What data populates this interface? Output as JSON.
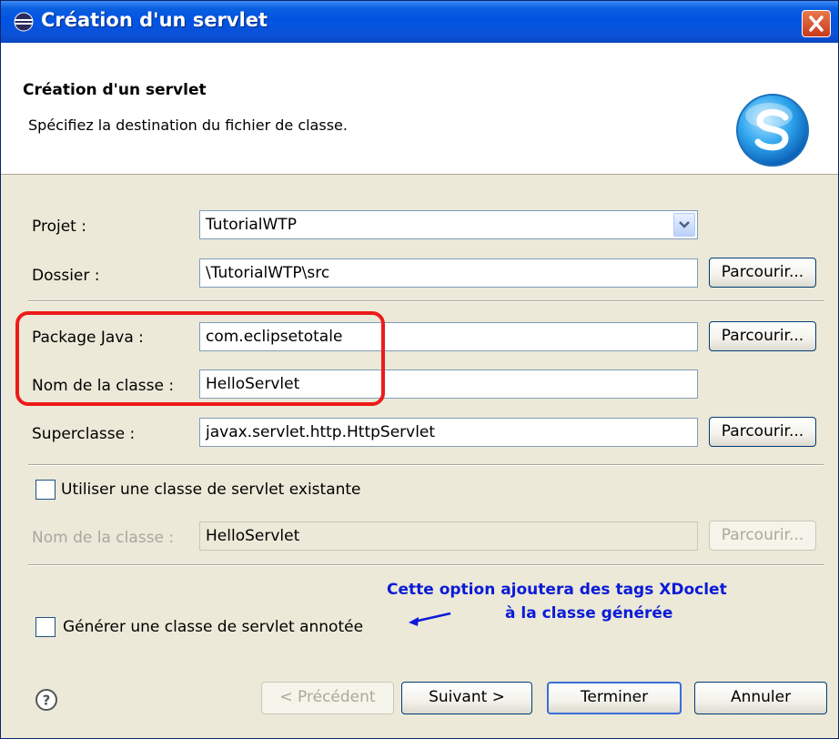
{
  "window": {
    "title": "Création d'un servlet"
  },
  "header": {
    "title": "Création d'un servlet",
    "description": "Spécifiez la destination du fichier de classe."
  },
  "form": {
    "project_label": "Projet :",
    "project_value": "TutorialWTP",
    "folder_label": "Dossier :",
    "folder_value": "\\TutorialWTP\\src",
    "package_label": "Package Java :",
    "package_value": "com.eclipsetotale",
    "class_label": "Nom de la classe :",
    "class_value": "HelloServlet",
    "superclass_label": "Superclasse :",
    "superclass_value": "javax.servlet.http.HttpServlet",
    "browse_label": "Parcourir...",
    "use_existing_label": "Utiliser une classe de servlet existante",
    "use_existing_checked": false,
    "existing_class_label": "Nom de la classe :",
    "existing_class_value": "HelloServlet",
    "annotated_label": "Générer une classe de servlet annotée",
    "annotated_checked": false
  },
  "annotation": {
    "line1": "Cette option ajoutera des tags XDoclet",
    "line2": "à la classe générée",
    "color": "#0b1bd6",
    "highlight_color": "#ec1b1b"
  },
  "footer": {
    "help_symbol": "?",
    "back_label": "< Précédent",
    "next_label": "Suivant >",
    "finish_label": "Terminer",
    "cancel_label": "Annuler"
  },
  "colors": {
    "titlebar": "#0054e3",
    "dialog_bg": "#ece9d8",
    "close_button": "#c9391a"
  }
}
